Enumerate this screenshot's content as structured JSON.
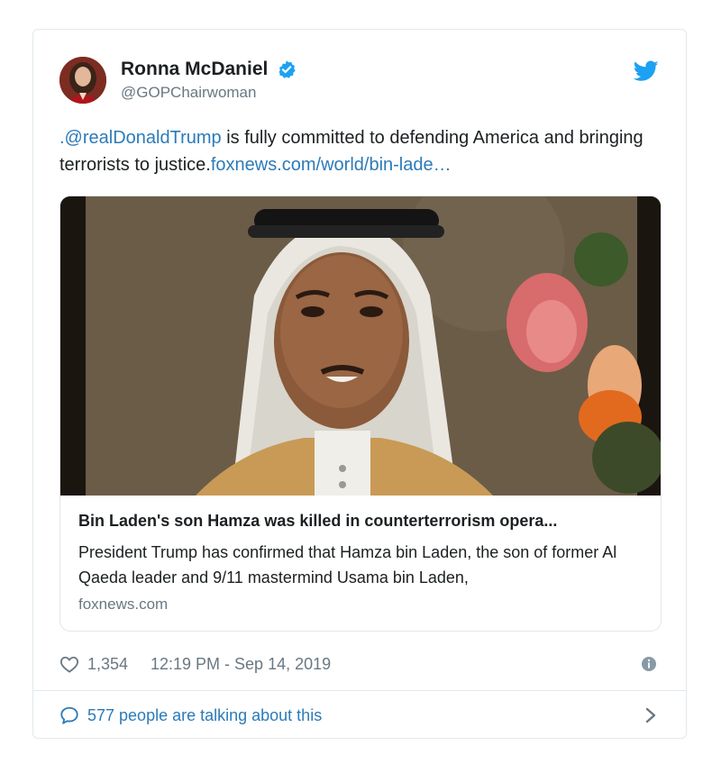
{
  "author": {
    "display_name": "Ronna McDaniel",
    "handle": "@GOPChairwoman",
    "verified_icon": "verified-badge-icon",
    "avatar_icon": "profile-photo"
  },
  "tweet": {
    "mention": ".@realDonaldTrump",
    "body_text": " is fully committed to defending America and bringing terrorists to justice.",
    "link_text": "foxnews.com/world/bin-lade…"
  },
  "link_card": {
    "title": "Bin Laden's son Hamza was killed in counterterrorism opera...",
    "description": "President Trump has confirmed that Hamza bin Laden, the son of former Al Qaeda leader and 9/11 mastermind Usama bin Laden,",
    "domain": "foxnews.com"
  },
  "meta": {
    "likes": "1,354",
    "timestamp": "12:19 PM - Sep 14, 2019"
  },
  "footer": {
    "talking_text": "577 people are talking about this"
  },
  "colors": {
    "link": "#2b7bb9",
    "muted": "#697882",
    "twitter_blue": "#1da1f2",
    "border": "#e1e8ed"
  }
}
